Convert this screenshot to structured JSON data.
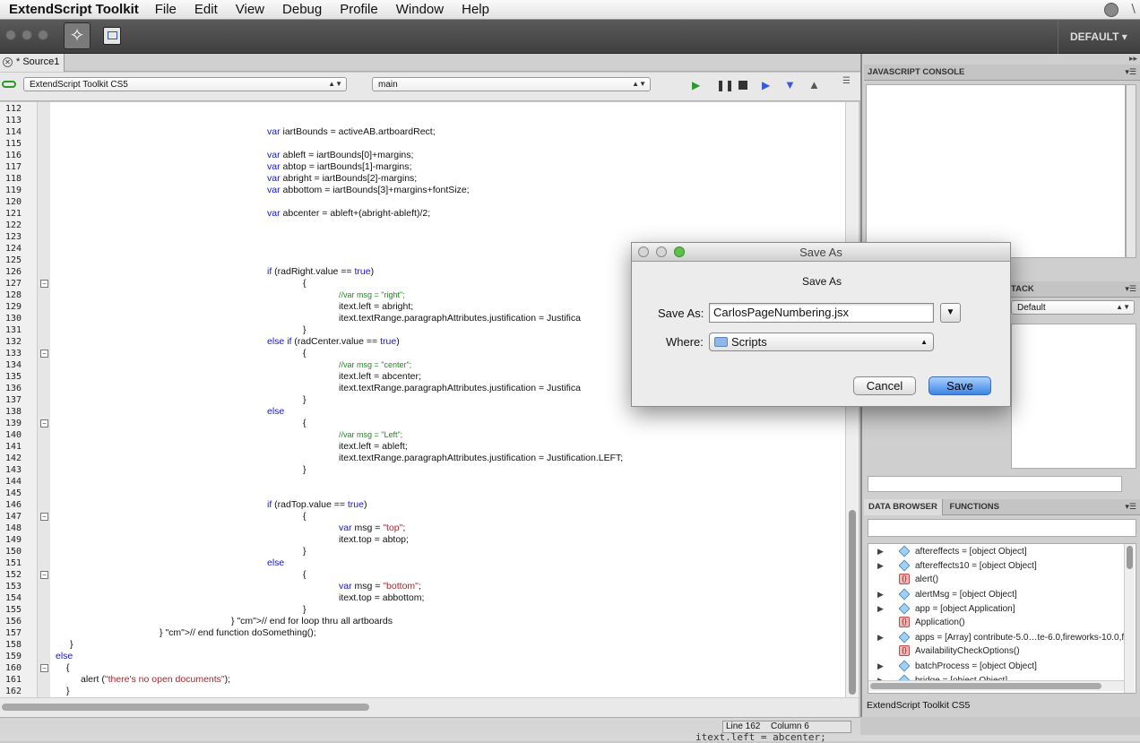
{
  "menubar": {
    "app": "ExtendScript Toolkit",
    "items": [
      "File",
      "Edit",
      "View",
      "Debug",
      "Profile",
      "Window",
      "Help"
    ]
  },
  "toolbar": {
    "workspace": "DEFAULT"
  },
  "editor": {
    "tab": "* Source1",
    "target_app": "ExtendScript Toolkit CS5",
    "engine": "main",
    "lines": [
      {
        "n": "112",
        "t": ""
      },
      {
        "n": "113",
        "t": ""
      },
      {
        "n": "114",
        "t": "var iartBounds = activeAB.artboardRect;"
      },
      {
        "n": "115",
        "t": ""
      },
      {
        "n": "116",
        "t": "var ableft = iartBounds[0]+margins;"
      },
      {
        "n": "117",
        "t": "var abtop = iartBounds[1]-margins;"
      },
      {
        "n": "118",
        "t": "var abright = iartBounds[2]-margins;"
      },
      {
        "n": "119",
        "t": "var abbottom = iartBounds[3]+margins+fontSize;"
      },
      {
        "n": "120",
        "t": ""
      },
      {
        "n": "121",
        "t": "var abcenter = ableft+(abright-ableft)/2;"
      },
      {
        "n": "122",
        "t": ""
      },
      {
        "n": "123",
        "t": ""
      },
      {
        "n": "124",
        "t": ""
      },
      {
        "n": "125",
        "t": ""
      },
      {
        "n": "126",
        "t": "if (radRight.value == true)"
      },
      {
        "n": "127",
        "t": "{"
      },
      {
        "n": "128",
        "t": "//var msg = \"right\";"
      },
      {
        "n": "129",
        "t": "itext.left = abright;"
      },
      {
        "n": "130",
        "t": "itext.textRange.paragraphAttributes.justification = Justifica"
      },
      {
        "n": "131",
        "t": "}"
      },
      {
        "n": "132",
        "t": "else if (radCenter.value == true)"
      },
      {
        "n": "133",
        "t": "{"
      },
      {
        "n": "134",
        "t": "//var msg = \"center\";"
      },
      {
        "n": "135",
        "t": "itext.left = abcenter;"
      },
      {
        "n": "136",
        "t": "itext.textRange.paragraphAttributes.justification = Justifica"
      },
      {
        "n": "137",
        "t": "}"
      },
      {
        "n": "138",
        "t": "else"
      },
      {
        "n": "139",
        "t": "{"
      },
      {
        "n": "140",
        "t": "//var msg = \"Left\";"
      },
      {
        "n": "141",
        "t": "itext.left = ableft;"
      },
      {
        "n": "142",
        "t": "itext.textRange.paragraphAttributes.justification = Justification.LEFT;"
      },
      {
        "n": "143",
        "t": "}"
      },
      {
        "n": "144",
        "t": ""
      },
      {
        "n": "145",
        "t": ""
      },
      {
        "n": "146",
        "t": "if (radTop.value == true)"
      },
      {
        "n": "147",
        "t": "{"
      },
      {
        "n": "148",
        "t": "var msg = \"top\";"
      },
      {
        "n": "149",
        "t": "itext.top = abtop;"
      },
      {
        "n": "150",
        "t": "}"
      },
      {
        "n": "151",
        "t": "else"
      },
      {
        "n": "152",
        "t": "{"
      },
      {
        "n": "153",
        "t": "var msg = \"bottom\";"
      },
      {
        "n": "154",
        "t": "itext.top = abbottom;"
      },
      {
        "n": "155",
        "t": "}"
      },
      {
        "n": "156",
        "t": "} // end for loop thru all artboards"
      },
      {
        "n": "157",
        "t": "} // end function doSomething();"
      },
      {
        "n": "158",
        "t": "}"
      },
      {
        "n": "159",
        "t": "else"
      },
      {
        "n": "160",
        "t": "{"
      },
      {
        "n": "161",
        "t": "alert (\"there's no open documents\");"
      },
      {
        "n": "162",
        "t": "}"
      }
    ]
  },
  "status": {
    "line": "Line 162",
    "column": "Column 6"
  },
  "right": {
    "console_tab": "JAVASCRIPT CONSOLE",
    "stack_tab": "TACK",
    "stack_select": "Default",
    "data_browser_tab": "DATA BROWSER",
    "functions_tab": "FUNCTIONS",
    "tree": [
      {
        "exp": true,
        "icon": "cube",
        "text": "aftereffects = [object Object]"
      },
      {
        "exp": true,
        "icon": "cube",
        "text": "aftereffects10 = [object Object]"
      },
      {
        "exp": false,
        "icon": "fn",
        "text": "alert()"
      },
      {
        "exp": true,
        "icon": "cube",
        "text": "alertMsg = [object Object]"
      },
      {
        "exp": true,
        "icon": "cube",
        "text": "app = [object Application]"
      },
      {
        "exp": false,
        "icon": "fn",
        "text": "Application()"
      },
      {
        "exp": true,
        "icon": "cube",
        "text": "apps = [Array] contribute-5.0…te-6.0,fireworks-10.0,f"
      },
      {
        "exp": false,
        "icon": "fn",
        "text": "AvailabilityCheckOptions()"
      },
      {
        "exp": true,
        "icon": "cube",
        "text": "batchProcess = [object Object]"
      },
      {
        "exp": true,
        "icon": "cube",
        "text": "bridge = [object Object]"
      }
    ],
    "footer": "ExtendScript Toolkit CS5"
  },
  "dialog": {
    "title": "Save As",
    "subtitle": "Save As",
    "save_as_label": "Save As:",
    "filename": "CarlosPageNumbering.jsx",
    "where_label": "Where:",
    "where_value": "Scripts",
    "cancel": "Cancel",
    "save": "Save"
  },
  "bottom_peek": "itext.left = abcenter;",
  "colors": {
    "keyword": "#1414d8",
    "string": "#a0282d",
    "comment": "#1a8a1a",
    "default_button": "#3b84e6"
  }
}
